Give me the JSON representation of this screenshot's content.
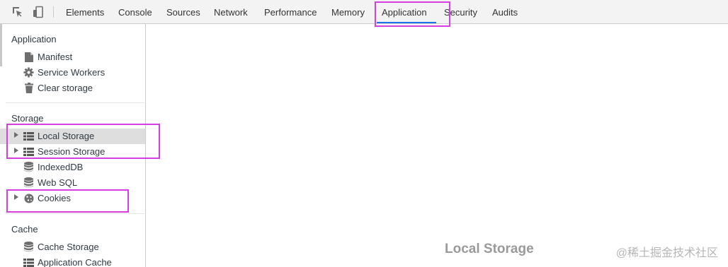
{
  "toolbar": {
    "tabs": [
      {
        "label": "Elements",
        "name": "tab-elements"
      },
      {
        "label": "Console",
        "name": "tab-console"
      },
      {
        "label": "Sources",
        "name": "tab-sources"
      },
      {
        "label": "Network",
        "name": "tab-network"
      },
      {
        "label": "Performance",
        "name": "tab-performance"
      },
      {
        "label": "Memory",
        "name": "tab-memory"
      },
      {
        "label": "Application",
        "name": "tab-application"
      },
      {
        "label": "Security",
        "name": "tab-security"
      },
      {
        "label": "Audits",
        "name": "tab-audits"
      }
    ],
    "active_tab": "Application",
    "icons": [
      "inspect-element-icon",
      "device-toolbar-icon"
    ]
  },
  "sidebar": {
    "application": {
      "title": "Application",
      "items": [
        {
          "label": "Manifest",
          "icon": "document-icon"
        },
        {
          "label": "Service Workers",
          "icon": "gear-icon"
        },
        {
          "label": "Clear storage",
          "icon": "trash-icon"
        }
      ]
    },
    "storage": {
      "title": "Storage",
      "items": [
        {
          "label": "Local Storage",
          "icon": "table-grid-icon",
          "expandable": true,
          "selected": true
        },
        {
          "label": "Session Storage",
          "icon": "table-grid-icon",
          "expandable": true
        },
        {
          "label": "IndexedDB",
          "icon": "database-icon"
        },
        {
          "label": "Web SQL",
          "icon": "database-icon"
        },
        {
          "label": "Cookies",
          "icon": "cookie-icon",
          "expandable": true
        }
      ]
    },
    "cache": {
      "title": "Cache",
      "items": [
        {
          "label": "Cache Storage",
          "icon": "database-icon"
        },
        {
          "label": "Application Cache",
          "icon": "table-grid-icon"
        }
      ]
    }
  },
  "main": {
    "pane_label": "Local Storage"
  },
  "watermark": "@稀土掘金技术社区",
  "colors": {
    "highlight": "#d63ee0",
    "active_tab_underline": "#1a73e8",
    "selected_row": "#dedede"
  }
}
